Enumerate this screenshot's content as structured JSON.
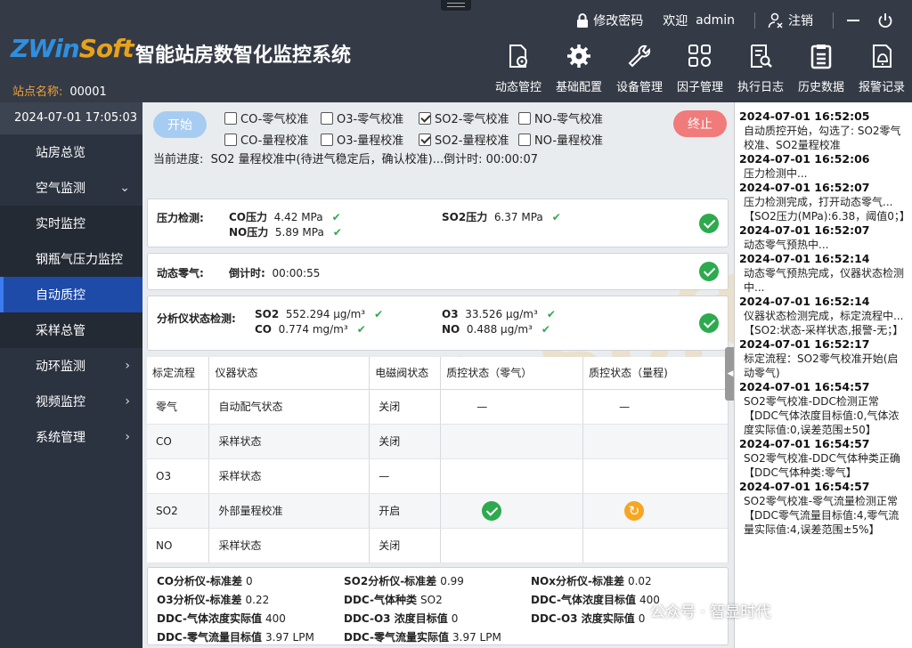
{
  "header": {
    "logo_text_a": "ZWin",
    "logo_text_b": "Soft",
    "title": "智能站房数智化监控系统",
    "station_label": "站点名称:",
    "station_value": "00001",
    "change_password": "修改密码",
    "welcome": "欢迎",
    "username": "admin",
    "logout": "注销",
    "toolbar": [
      {
        "label": "动态管控",
        "icon": "gear-document-icon"
      },
      {
        "label": "基础配置",
        "icon": "gear-icon"
      },
      {
        "label": "设备管理",
        "icon": "wrench-icon"
      },
      {
        "label": "因子管理",
        "icon": "grid-gear-icon"
      },
      {
        "label": "执行日志",
        "icon": "search-document-icon"
      },
      {
        "label": "历史数据",
        "icon": "clipboard-icon"
      },
      {
        "label": "报警记录",
        "icon": "bell-document-icon"
      }
    ]
  },
  "sidebar": {
    "datetime": "2024-07-01 17:05:03",
    "items": [
      {
        "label": "站房总览",
        "type": "top"
      },
      {
        "label": "空气监测",
        "type": "top",
        "chev": "⌄"
      },
      {
        "label": "实时监控",
        "type": "sub"
      },
      {
        "label": "钢瓶气压力监控",
        "type": "sub"
      },
      {
        "label": "自动质控",
        "type": "sub",
        "active": true
      },
      {
        "label": "采样总管",
        "type": "sub"
      },
      {
        "label": "动环监测",
        "type": "top",
        "chev": "›"
      },
      {
        "label": "视频监控",
        "type": "top",
        "chev": "›"
      },
      {
        "label": "系统管理",
        "type": "top",
        "chev": "›"
      }
    ]
  },
  "controls": {
    "start": "开始",
    "stop": "终止",
    "checks": [
      {
        "label": "CO-零气校准",
        "checked": false
      },
      {
        "label": "O3-零气校准",
        "checked": false
      },
      {
        "label": "SO2-零气校准",
        "checked": true
      },
      {
        "label": "NO-零气校准",
        "checked": false
      },
      {
        "label": "CO-量程校准",
        "checked": false
      },
      {
        "label": "O3-量程校准",
        "checked": false
      },
      {
        "label": "SO2-量程校准",
        "checked": true
      },
      {
        "label": "NO-量程校准",
        "checked": false
      }
    ],
    "progress_label": "当前进度:",
    "progress_text": "SO2 量程校准中(待进气稳定后，确认校准)...倒计时: 00:00:07"
  },
  "pressure": {
    "label": "压力检测:",
    "co_k": "CO压力",
    "co_v": "4.42 MPa",
    "no_k": "NO压力",
    "no_v": "5.89 MPa",
    "so2_k": "SO2压力",
    "so2_v": "6.37 MPa"
  },
  "zero": {
    "label": "动态零气:",
    "countdown_k": "倒计时:",
    "countdown_v": "00:00:55"
  },
  "analyzer": {
    "label": "分析仪状态检测:",
    "so2_k": "SO2",
    "so2_v": "552.294 μg/m³",
    "co_k": "CO",
    "co_v": "0.774 mg/m³",
    "o3_k": "O3",
    "o3_v": "33.526 μg/m³",
    "no_k": "NO",
    "no_v": "0.488 μg/m³"
  },
  "table": {
    "headers": [
      "标定流程",
      "仪器状态",
      "电磁阀状态",
      "质控状态（零气）",
      "质控状态（量程)"
    ],
    "rows": [
      {
        "flow": "零气",
        "instrument": "自动配气状态",
        "valve": "关闭",
        "zero": "—",
        "span": "—"
      },
      {
        "flow": "CO",
        "instrument": "采样状态",
        "valve": "关闭",
        "zero": "",
        "span": ""
      },
      {
        "flow": "O3",
        "instrument": "采样状态",
        "valve": "—",
        "zero": "",
        "span": ""
      },
      {
        "flow": "SO2",
        "instrument": "外部量程校准",
        "valve": "开启",
        "zero": "ok",
        "span": "busy"
      },
      {
        "flow": "NO",
        "instrument": "采样状态",
        "valve": "关闭",
        "zero": "",
        "span": ""
      }
    ]
  },
  "stats": [
    {
      "k": "CO分析仪-标准差",
      "v": "0"
    },
    {
      "k": "SO2分析仪-标准差",
      "v": "0.99"
    },
    {
      "k": "NOx分析仪-标准差",
      "v": "0.02"
    },
    {
      "k": "O3分析仪-标准差",
      "v": "0.22"
    },
    {
      "k": "DDC-气体种类",
      "v": "SO2"
    },
    {
      "k": "DDC-气体浓度目标值",
      "v": "400"
    },
    {
      "k": "DDC-气体浓度实际值",
      "v": "400"
    },
    {
      "k": "DDC-O3 浓度目标值",
      "v": "0"
    },
    {
      "k": "DDC-O3 浓度实际值",
      "v": "0"
    },
    {
      "k": "DDC-零气流量目标值",
      "v": "3.97 LPM"
    },
    {
      "k": "DDC-零气流量实际值",
      "v": "3.97 LPM"
    }
  ],
  "log": [
    {
      "t": "2024-07-01 16:52:05",
      "m": "自动质控开始，勾选了: SO2零气校准、SO2量程校准"
    },
    {
      "t": "2024-07-01 16:52:06",
      "m": "压力检测中..."
    },
    {
      "t": "2024-07-01 16:52:07",
      "m": "压力检测完成，打开动态零气...【SO2压力(MPa):6.38，阈值0；】"
    },
    {
      "t": "2024-07-01 16:52:07",
      "m": "动态零气预热中..."
    },
    {
      "t": "2024-07-01 16:52:14",
      "m": "动态零气预热完成，仪器状态检测中..."
    },
    {
      "t": "2024-07-01 16:52:14",
      "m": "仪器状态检测完成，标定流程中...【SO2:状态-采样状态,报警-无；】"
    },
    {
      "t": "2024-07-01 16:52:17",
      "m": "标定流程：SO2零气校准开始(启动零气)"
    },
    {
      "t": "2024-07-01 16:54:57",
      "m": "SO2零气校准-DDC检测正常【DDC气体浓度目标值:0,气体浓度实际值:0,误差范围±50】"
    },
    {
      "t": "2024-07-01 16:54:57",
      "m": "SO2零气校准-DDC气体种类正确【DDC气体种类:零气】"
    },
    {
      "t": "2024-07-01 16:54:57",
      "m": "SO2零气校准-零气流量检测正常【DDC零气流量目标值:4,零气流量实际值:4,误差范围±5%】"
    }
  ],
  "credit": "公众号 · 智显时代",
  "colors": {
    "accent": "#1e4aa8",
    "ok": "#2eaa4e",
    "warn": "#f5a623",
    "stop": "#f17a7a"
  }
}
